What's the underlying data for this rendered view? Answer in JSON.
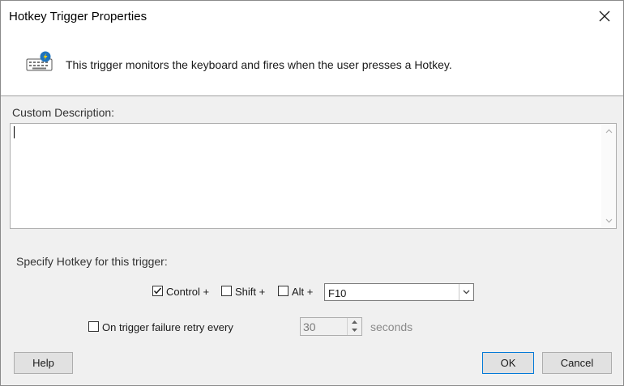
{
  "window": {
    "title": "Hotkey Trigger Properties",
    "close_icon": "close-icon"
  },
  "header": {
    "icon": "keyboard-lightning-icon",
    "description": "This trigger monitors the keyboard and fires when the user presses a Hotkey."
  },
  "custom_description": {
    "label": "Custom Description:",
    "value": ""
  },
  "hotkey": {
    "label": "Specify Hotkey for this trigger:",
    "control": {
      "label": "Control +",
      "checked": true
    },
    "shift": {
      "label": "Shift +",
      "checked": false
    },
    "alt": {
      "label": "Alt +",
      "checked": false
    },
    "key": "F10"
  },
  "retry": {
    "label": "On trigger failure retry every",
    "checked": false,
    "value": "30",
    "unit": "seconds"
  },
  "buttons": {
    "help": "Help",
    "ok": "OK",
    "cancel": "Cancel"
  },
  "colors": {
    "accent": "#0078d7",
    "dialog_bg": "#f0f0f0"
  }
}
